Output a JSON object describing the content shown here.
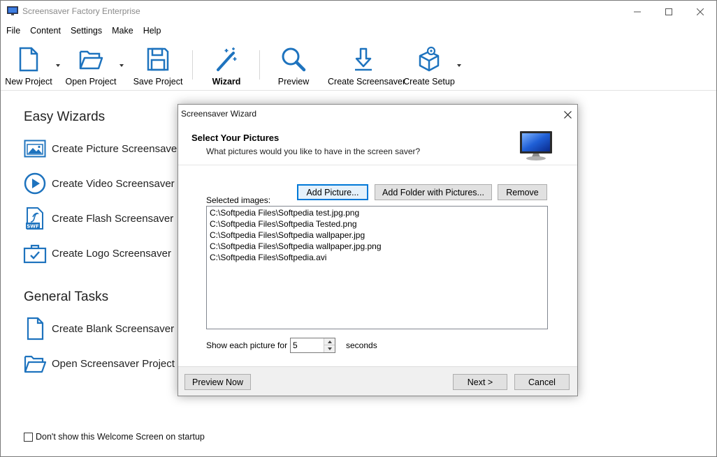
{
  "window": {
    "title": "Screensaver Factory Enterprise"
  },
  "menu": [
    "File",
    "Content",
    "Settings",
    "Make",
    "Help"
  ],
  "toolbar": {
    "new_project": "New Project",
    "open_project": "Open Project",
    "save_project": "Save Project",
    "wizard": "Wizard",
    "preview": "Preview",
    "create_screensaver": "Create Screensaver",
    "create_setup": "Create Setup"
  },
  "easy_wizards": {
    "title": "Easy Wizards",
    "items": [
      "Create Picture Screensaver",
      "Create Video Screensaver",
      "Create Flash Screensaver",
      "Create Logo Screensaver"
    ]
  },
  "general_tasks": {
    "title": "General Tasks",
    "items": [
      "Create Blank Screensaver",
      "Open Screensaver Project"
    ]
  },
  "startup_checkbox": {
    "label": "Don't show this Welcome Screen on startup",
    "checked": false
  },
  "dialog": {
    "title": "Screensaver Wizard",
    "heading": "Select Your Pictures",
    "subheading": "What pictures would you like to have in the screen saver?",
    "add_picture": "Add Picture...",
    "add_folder": "Add Folder with Pictures...",
    "remove": "Remove",
    "selected_label": "Selected images:",
    "images": [
      "C:\\Softpedia Files\\Softpedia test.jpg.png",
      "C:\\Softpedia Files\\Softpedia Tested.png",
      "C:\\Softpedia Files\\Softpedia wallpaper.jpg",
      "C:\\Softpedia Files\\Softpedia wallpaper.jpg.png",
      "C:\\Softpedia Files\\Softpedia.avi"
    ],
    "show_each_label": "Show each picture for",
    "seconds_value": "5",
    "seconds_label": "seconds",
    "preview_now": "Preview Now",
    "next": "Next >",
    "cancel": "Cancel"
  },
  "colors": {
    "icon_blue": "#1e73be",
    "default_button_border": "#0078d7"
  }
}
